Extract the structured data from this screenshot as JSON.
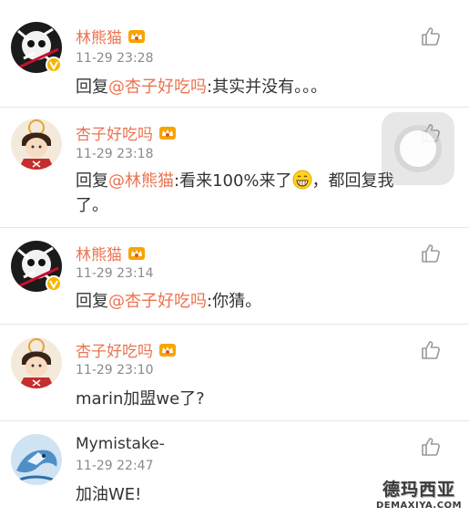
{
  "comments": [
    {
      "name": "林熊猫",
      "time": "11-29 23:28",
      "reply_prefix": "回复",
      "mention": "@杏子好吃吗",
      "body": ":其实并没有。。。"
    },
    {
      "name": "杏子好吃吗",
      "time": "11-29 23:18",
      "reply_prefix": "回复",
      "mention": "@林熊猫",
      "body_before_emoji": ":看来100%来了",
      "body_after_emoji": "，都回复我了。"
    },
    {
      "name": "林熊猫",
      "time": "11-29 23:14",
      "reply_prefix": "回复",
      "mention": "@杏子好吃吗",
      "body": ":你猜。"
    },
    {
      "name": "杏子好吃吗",
      "time": "11-29 23:10",
      "body": "marin加盟we了?"
    },
    {
      "name": "Mymistake-",
      "time": "11-29 22:47",
      "body": "加油WE!"
    }
  ],
  "watermark": {
    "title": "德玛西亚",
    "url": "DEMAXIYA.COM"
  },
  "colors": {
    "name_orange": "#eb7350",
    "time_gray": "#8a8a8a",
    "text_dark": "#333333",
    "badge_gold": "#f6b600"
  },
  "icons": {
    "like": "thumbs-up-icon",
    "vip": "vip-crown-icon",
    "verified": "verified-v-icon",
    "emoji": "grin-emoji-icon"
  }
}
